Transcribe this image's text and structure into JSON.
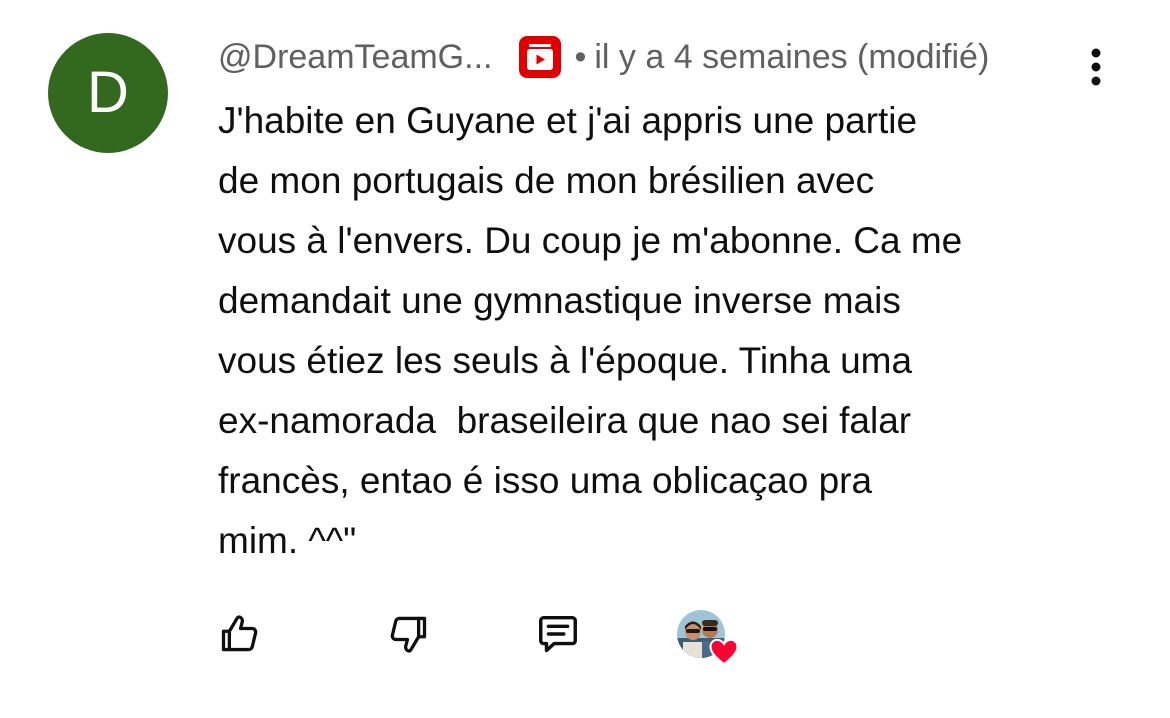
{
  "comment": {
    "avatar_letter": "D",
    "avatar_color": "#33691e",
    "handle": "@DreamTeamG...",
    "badge_icon": "member-badge-icon",
    "separator": "•",
    "timestamp": "il y a 4 semaines (modifié)",
    "text": "J'habite en Guyane et j'ai appris une partie\nde mon portugais de mon brésilien avec\nvous à l'envers. Du coup je m'abonne. Ca me\ndemandait une gymnastique inverse mais\nvous étiez les seuls à l'époque. Tinha uma\nex-namorada  braseileira que nao sei falar\nfrancès, entao é isso uma oblicaçao pra\nmim. ^^\""
  },
  "actions": {
    "like_icon": "thumb-up-icon",
    "dislike_icon": "thumb-down-icon",
    "reply_icon": "comment-reply-icon",
    "creator_heart_icon": "heart-icon",
    "heart_color": "#ff0033"
  },
  "colors": {
    "badge_red": "#e00000",
    "meta_gray": "#606060",
    "text": "#0f0f0f"
  }
}
